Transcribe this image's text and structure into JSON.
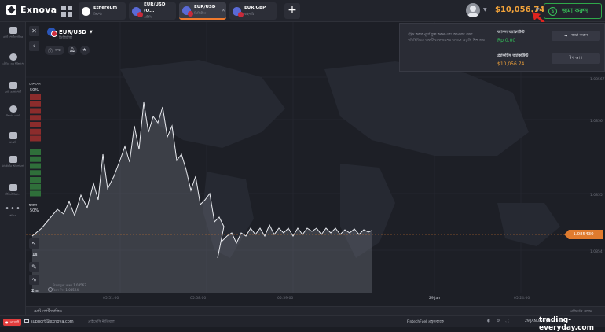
{
  "app": {
    "name": "Exnova"
  },
  "tabs": [
    {
      "name": "Ethereum",
      "sub": "ক্রিপ্টো",
      "icon": "ethereum-icon",
      "active": false
    },
    {
      "name": "EUR/USD (O...",
      "sub": "ওটিসি",
      "icon": "eurusd-flag-icon",
      "active": false
    },
    {
      "name": "EUR/USD",
      "sub": "ডিজিটাল",
      "icon": "eurusd-flag-icon",
      "active": true
    },
    {
      "name": "EUR/GBP",
      "sub": "বাইনারি",
      "icon": "eurgbp-flag-icon",
      "active": false
    }
  ],
  "header": {
    "balance": "$10,056.74",
    "deposit_label": "জমা করুন",
    "add_tab": "+"
  },
  "sidebar": [
    {
      "icon": "portfolio-icon",
      "label": "মোট পোর্টফোলিও"
    },
    {
      "icon": "history-icon",
      "label": "ট্রেডিং এর ইতিহাস"
    },
    {
      "icon": "chat-icon",
      "label": "চ্যাট ও সাপোর্ট"
    },
    {
      "icon": "leaderboard-icon",
      "label": "লিডার বোর্ড"
    },
    {
      "icon": "market-icon",
      "label": "মার্কেট"
    },
    {
      "icon": "analysis-icon",
      "label": "মার্কেটের আলোচনা"
    },
    {
      "icon": "education-icon",
      "label": "টিউটোরিয়াল"
    },
    {
      "icon": "more-icon",
      "label": "আরও"
    }
  ],
  "chart": {
    "pair": "EUR/USD",
    "pair_sub": "ডিজিটাল",
    "info_label": "তথ্য",
    "sentiment_top_label": "লেনদেন",
    "sentiment_top_pct": "50%",
    "sentiment_bottom_label": "হারাব",
    "sentiment_bottom_pct": "50%",
    "current_price": "1.085430",
    "y_ticks": [
      "1.08567",
      "1.0856",
      "1.0855",
      "1.0854"
    ],
    "time_labels": [
      "05:51:00",
      "05:58:00",
      "05:59:00",
      "29 Jan",
      "05:24:00"
    ],
    "timeframe_1": "1s",
    "timeframe_2": "2m",
    "bottom_info_1": "বিক্রয়মূল্য করুন 1.08563",
    "bottom_info_2": "কিনে নিন 1.08524",
    "y_max": 1.08575,
    "y_min": 1.08535
  },
  "chart_data": {
    "type": "line",
    "x": [
      "05:51:00",
      "05:58:00",
      "05:59:00"
    ],
    "values": [
      1.08543,
      1.08548,
      1.0856,
      1.08566,
      1.08563,
      1.08556,
      1.08549,
      1.0854,
      1.08541,
      1.08544,
      1.08543,
      1.08543
    ],
    "ylim": [
      1.0853,
      1.0857
    ]
  },
  "popup": {
    "text": "ট্রেড করার পূর্বে যুক্ত করুন এবং আপনার সেরা পরিস্থিতিতে একটি ব্যাকআপের এখানে প্রস্তুতি নিন তথ্য",
    "real_account": "আসল অ্যাকাউন্ট",
    "real_balance": "Rp 0.00",
    "real_action": "জমা করুন",
    "practice_account": "প্র্যাকটিস অ্যাকাউন্ট",
    "practice_balance": "$10,056.74",
    "practice_action": "টপ আপ"
  },
  "portfolio": {
    "label": "মোট পোর্টফোলিও",
    "right": "পরিবর্তন দেখান"
  },
  "footer": {
    "live_label": "সাপোর্ট",
    "email": "support@exnova.com",
    "links": "প্রাইভেসি নীতিমালা",
    "news": "FintechFuel প্রস্তুতকারক",
    "time": "29 JANUARY, 05:25:19",
    "watermark": "trading-everyday.com"
  }
}
